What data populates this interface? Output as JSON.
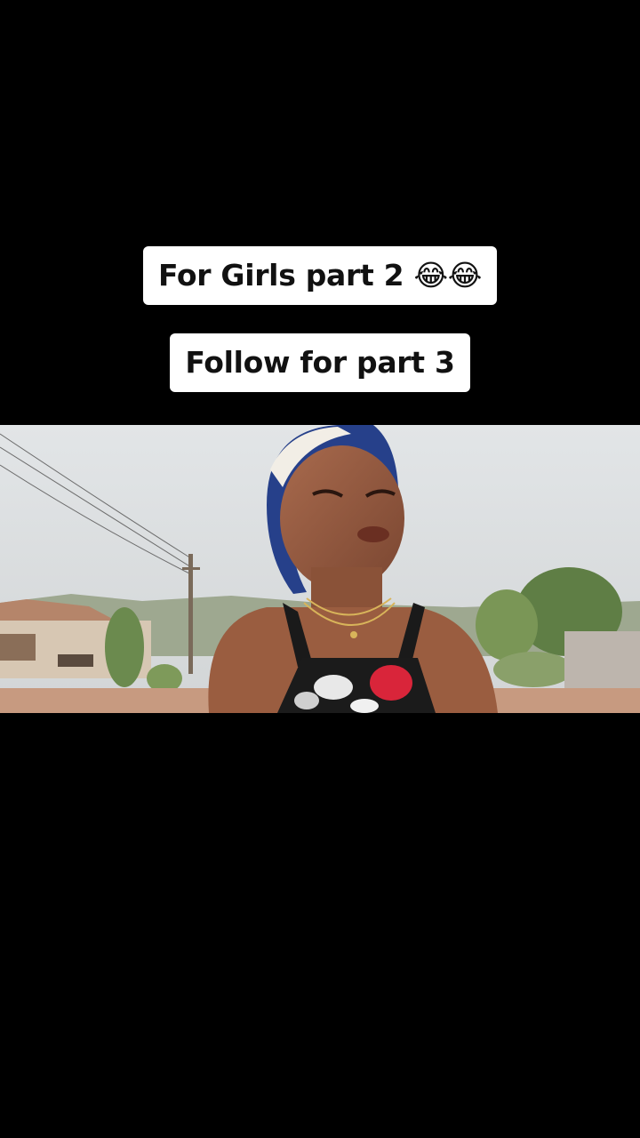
{
  "captions": [
    {
      "text": "For Girls part 2 😂😂"
    },
    {
      "text": "Follow for part 3"
    }
  ],
  "colors": {
    "background": "#000000",
    "caption_bg": "#ffffff",
    "caption_text": "#111111"
  }
}
